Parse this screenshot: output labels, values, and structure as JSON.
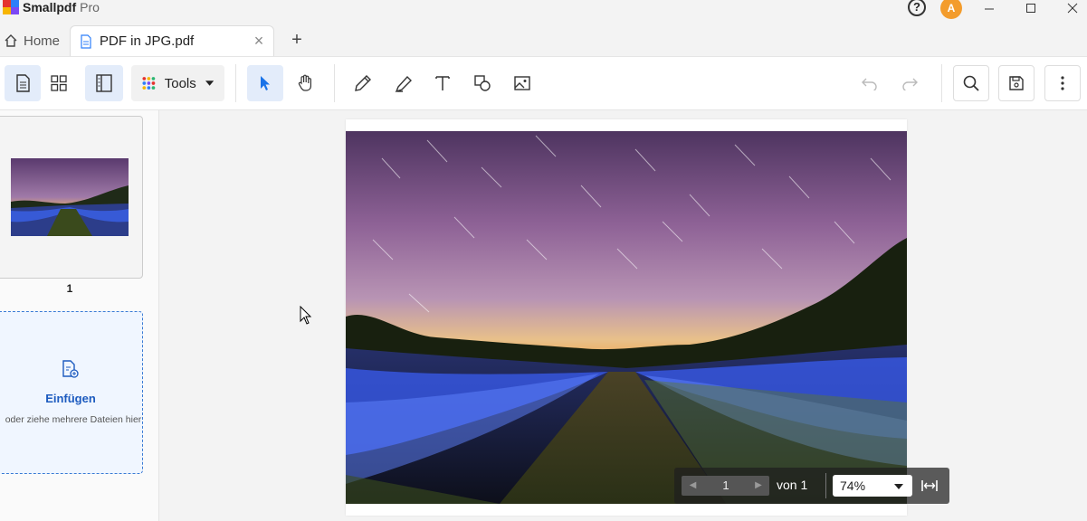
{
  "app": {
    "name": "Smallpdf",
    "edition": "Pro",
    "user_initial": "A"
  },
  "tabs": {
    "home_label": "Home",
    "active_label": "PDF in JPG.pdf"
  },
  "toolbar": {
    "tools_label": "Tools"
  },
  "sidebar": {
    "pages": [
      {
        "number": "1"
      }
    ],
    "insert": {
      "label": "Einfügen",
      "hint": "oder ziehe mehrere Dateien hier"
    }
  },
  "pager": {
    "current_page": "1",
    "of_label": "von 1",
    "zoom": "74%"
  },
  "colors": {
    "accent": "#1a73e8",
    "avatar": "#f39c2c",
    "selected_bg": "#e3ecfa"
  }
}
